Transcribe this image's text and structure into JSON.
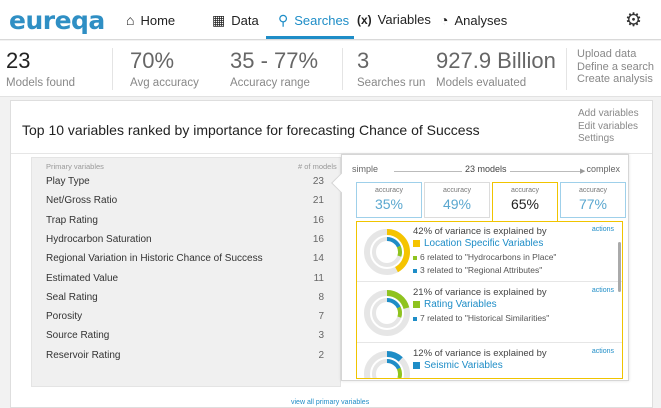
{
  "app": {
    "logo": "eureqa"
  },
  "nav": {
    "items": [
      {
        "label": "Home",
        "icon": "home-icon",
        "glyph": "⌂"
      },
      {
        "label": "Data",
        "icon": "data-grid-icon",
        "glyph": "▦"
      },
      {
        "label": "Searches",
        "icon": "searches-icon",
        "glyph": "⚲"
      },
      {
        "label": "Variables",
        "icon": "variables-icon",
        "glyph": "(x)"
      },
      {
        "label": "Analyses",
        "icon": "analyses-pie-icon",
        "glyph": "◔"
      }
    ],
    "active": "Searches",
    "settings_icon": "gear-icon"
  },
  "stats": [
    {
      "value": "23",
      "label": "Models found"
    },
    {
      "value": "70%",
      "label": "Avg accuracy"
    },
    {
      "value": "35 - 77%",
      "label": "Accuracy range"
    },
    {
      "value": "3",
      "label": "Searches run"
    },
    {
      "value": "927.9 Billion",
      "label": "Models evaluated"
    }
  ],
  "quick_links": [
    "Upload data",
    "Define a search",
    "Create analysis"
  ],
  "card": {
    "title": "Top 10 variables ranked by importance for forecasting Chance of Success",
    "links": [
      "Add variables",
      "Edit variables",
      "Settings"
    ],
    "list_header_left": "Primary variables",
    "list_header_right": "# of models",
    "variables": [
      {
        "name": "Play Type",
        "count": "23"
      },
      {
        "name": "Net/Gross Ratio",
        "count": "21"
      },
      {
        "name": "Trap Rating",
        "count": "16"
      },
      {
        "name": "Hydrocarbon Saturation",
        "count": "16"
      },
      {
        "name": "Regional Variation in Historic Chance of Success",
        "count": "14"
      },
      {
        "name": "Estimated Value",
        "count": "11"
      },
      {
        "name": "Seal Rating",
        "count": "8"
      },
      {
        "name": "Porosity",
        "count": "7"
      },
      {
        "name": "Source Rating",
        "count": "3"
      },
      {
        "name": "Reservoir Rating",
        "count": "2"
      }
    ],
    "view_all": "view all primary variables"
  },
  "models_panel": {
    "scale_left": "simple",
    "scale_mid": "23 models",
    "scale_right": "complex",
    "accuracy_label": "accuracy",
    "accuracies": [
      "35%",
      "49%",
      "65%",
      "77%"
    ],
    "selected_accuracy": "65%",
    "items": [
      {
        "variance": "42% of variance is explained by",
        "group": "Location Specific Variables",
        "color": "#f5c400",
        "details": [
          {
            "text": "6 related to \"Hydrocarbons in Place\"",
            "color": "#8fc31f"
          },
          {
            "text": "3 related to \"Regional Attributes\"",
            "color": "#1e8dc7"
          }
        ],
        "actions": "actions"
      },
      {
        "variance": "21% of variance is explained by",
        "group": "Rating Variables",
        "color": "#8fc31f",
        "details": [
          {
            "text": "7 related to \"Historical Similarities\"",
            "color": "#1e8dc7"
          }
        ],
        "actions": "actions"
      },
      {
        "variance": "12% of variance is explained by",
        "group": "Seismic Variables",
        "color": "#1e8dc7",
        "details": [],
        "actions": "actions"
      }
    ],
    "variance_shares": [
      42,
      21,
      12
    ]
  }
}
